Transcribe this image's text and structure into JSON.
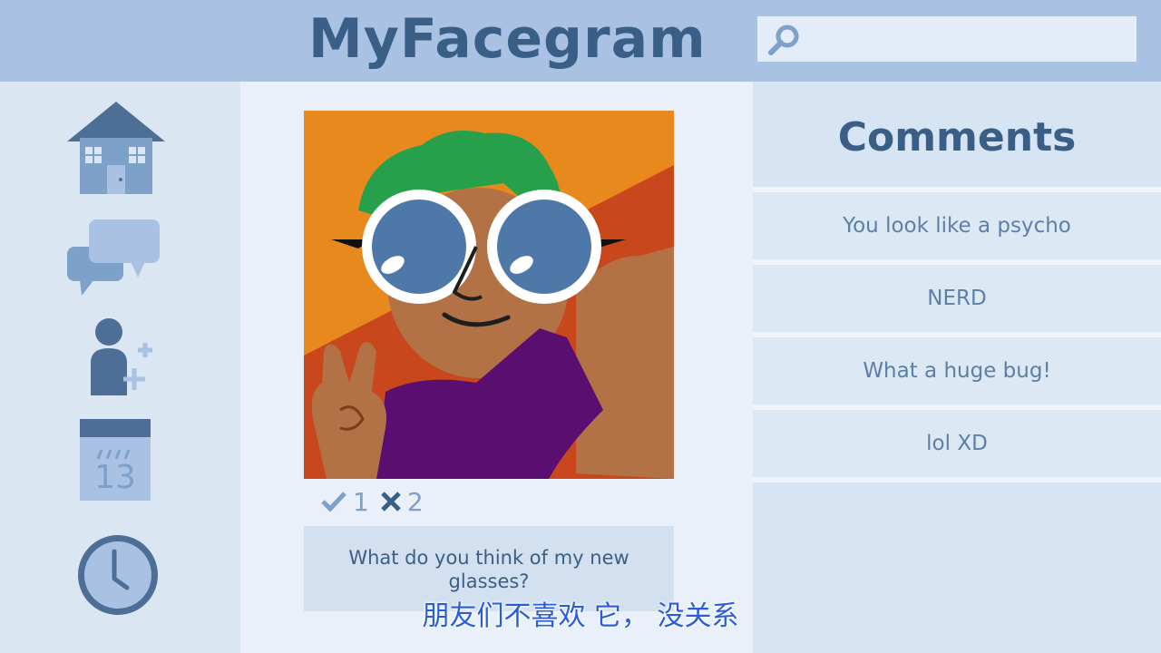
{
  "app": {
    "title": "MyFacegram"
  },
  "search": {
    "placeholder": "",
    "icon": "search-icon"
  },
  "sidebar": {
    "items": [
      {
        "name": "home",
        "icon": "house-icon"
      },
      {
        "name": "messages",
        "icon": "chat-bubbles-icon"
      },
      {
        "name": "add-friend",
        "icon": "add-user-icon"
      },
      {
        "name": "calendar",
        "icon": "calendar-icon",
        "date": "13"
      },
      {
        "name": "history",
        "icon": "clock-icon"
      }
    ]
  },
  "post": {
    "image": "selfie-photo-green-hair-big-glasses",
    "likes": "1",
    "dislikes": "2",
    "caption": "What do you think of my new glasses?"
  },
  "comments": {
    "title": "Comments",
    "items": [
      "You look like a psycho",
      "NERD",
      "What a huge bug!",
      "lol XD"
    ]
  },
  "subtitle": "朋友们不喜欢 它， 没关系",
  "colors": {
    "header": "#a9c2e3",
    "accent": "#3a5f86",
    "subtitle": "#2a5dd8"
  }
}
